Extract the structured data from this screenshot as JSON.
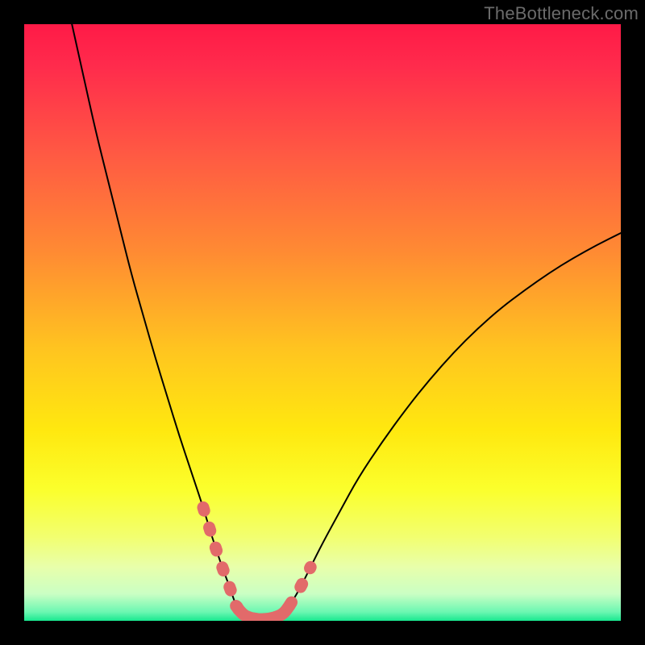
{
  "watermark": {
    "text": "TheBottleneck.com"
  },
  "chart_data": {
    "type": "line",
    "title": "",
    "xlabel": "",
    "ylabel": "",
    "xlim": [
      0,
      100
    ],
    "ylim": [
      0,
      100
    ],
    "gradient_stops": [
      {
        "pos": 0,
        "color": "#ff1a47"
      },
      {
        "pos": 0.07,
        "color": "#ff2b4c"
      },
      {
        "pos": 0.22,
        "color": "#ff5a43"
      },
      {
        "pos": 0.38,
        "color": "#ff8a33"
      },
      {
        "pos": 0.55,
        "color": "#ffc61f"
      },
      {
        "pos": 0.68,
        "color": "#ffe80f"
      },
      {
        "pos": 0.78,
        "color": "#fbff2c"
      },
      {
        "pos": 0.86,
        "color": "#f2ff70"
      },
      {
        "pos": 0.91,
        "color": "#e8ffab"
      },
      {
        "pos": 0.955,
        "color": "#caffc4"
      },
      {
        "pos": 0.985,
        "color": "#6cf7b2"
      },
      {
        "pos": 1.0,
        "color": "#18e88f"
      }
    ],
    "series": [
      {
        "name": "left-branch",
        "x": [
          8,
          10,
          12,
          14,
          16,
          18,
          20,
          22,
          24,
          26,
          28,
          30,
          31.5,
          33,
          34.5,
          35.5
        ],
        "y": [
          100,
          91,
          82,
          74,
          66,
          58,
          51,
          44,
          37.5,
          31,
          25,
          19,
          14,
          9.5,
          5.5,
          2.5
        ]
      },
      {
        "name": "valley-floor",
        "x": [
          35.5,
          36.5,
          38,
          40,
          42,
          43.5,
          44.5
        ],
        "y": [
          2.5,
          1.1,
          0.4,
          0.2,
          0.5,
          1.2,
          2.6
        ]
      },
      {
        "name": "right-branch",
        "x": [
          44.5,
          46,
          48,
          50,
          53,
          56,
          60,
          64,
          68,
          72,
          76,
          80,
          84,
          88,
          92,
          96,
          100
        ],
        "y": [
          2.6,
          5,
          9,
          13,
          18.5,
          24,
          30,
          35.5,
          40.5,
          45,
          49,
          52.5,
          55.5,
          58.3,
          60.8,
          63,
          65
        ]
      }
    ],
    "highlight_segments": [
      {
        "branch": "left",
        "x": [
          30,
          35.5
        ],
        "y": [
          19,
          2.5
        ]
      },
      {
        "branch": "floor",
        "x": [
          35.5,
          44.5
        ],
        "y": [
          2.5,
          2.6
        ]
      },
      {
        "branch": "right",
        "x": [
          44.5,
          49
        ],
        "y": [
          2.6,
          11
        ]
      }
    ],
    "highlight_color": "#e26a6a",
    "line_color": "#000000"
  }
}
